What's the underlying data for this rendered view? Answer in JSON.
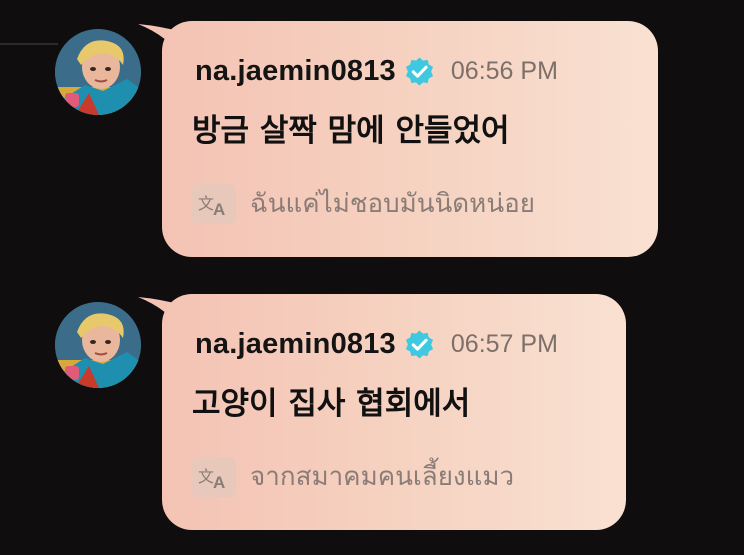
{
  "messages": [
    {
      "username": "na.jaemin0813",
      "verified": true,
      "time": "06:56 PM",
      "text": "방금 살짝 맘에 안들었어",
      "translation": "ฉันแค่ไม่ชอบมันนิดหน่อย",
      "translate_icon": "translate-icon"
    },
    {
      "username": "na.jaemin0813",
      "verified": true,
      "time": "06:57 PM",
      "text": "고양이 집사 협회에서",
      "translation": "จากสมาคมคนเลี้ยงแมว",
      "translate_icon": "translate-icon"
    }
  ],
  "colors": {
    "background": "#0f0d0e",
    "bubble_start": "#f4c3b4",
    "bubble_end": "#f9e1d2",
    "verified_badge": "#3ec9e0",
    "time_text": "#7d6f69"
  }
}
